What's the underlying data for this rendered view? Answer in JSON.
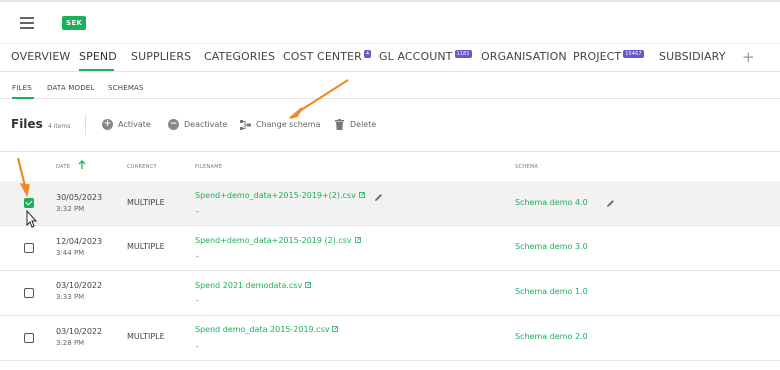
{
  "topbar": {
    "currency": "SEK",
    "menu_icon": "hamburger-icon"
  },
  "nav": {
    "items": [
      {
        "label": "OVERVIEW"
      },
      {
        "label": "SPEND"
      },
      {
        "label": "SUPPLIERS"
      },
      {
        "label": "CATEGORIES"
      },
      {
        "label": "COST CENTER",
        "badge": "4"
      },
      {
        "label": "GL ACCOUNT",
        "badge": "1181"
      },
      {
        "label": "ORGANISATION"
      },
      {
        "label": "PROJECT",
        "badge": "15467"
      },
      {
        "label": "SUBSIDIARY"
      }
    ],
    "active": "SPEND",
    "add_label": "+"
  },
  "subnav": {
    "items": [
      {
        "label": "FILES"
      },
      {
        "label": "DATA MODEL"
      },
      {
        "label": "SCHEMAS"
      }
    ],
    "active": "FILES"
  },
  "toolbar": {
    "title": "Files",
    "count": "4 items",
    "activate": "Activate",
    "deactivate": "Deactivate",
    "change_schema": "Change schema",
    "delete": "Delete"
  },
  "table": {
    "headers": {
      "date": "DATE",
      "currency": "CURRENCY",
      "filename": "FILENAME",
      "schema": "SCHEMA"
    },
    "sort": "ascending",
    "rows": [
      {
        "checked": true,
        "date": "30/05/2023",
        "time": "3:32 PM",
        "currency": "MULTIPLE",
        "filename": "Spend+demo_data+2015-2019+(2).csv",
        "sub": "-",
        "schema": "Schema demo 4.0"
      },
      {
        "checked": false,
        "date": "12/04/2023",
        "time": "3:44 PM",
        "currency": "MULTIPLE",
        "filename": "Spend+demo_data+2015-2019 (2).csv",
        "sub": "-",
        "schema": "Schema demo 3.0"
      },
      {
        "checked": false,
        "date": "03/10/2022",
        "time": "3:33 PM",
        "currency": "",
        "filename": "Spend 2021 demodata.csv",
        "sub": "-",
        "schema": "Schema demo 1.0"
      },
      {
        "checked": false,
        "date": "03/10/2022",
        "time": "3:28 PM",
        "currency": "MULTIPLE",
        "filename": "Spend demo_data 2015-2019.csv",
        "sub": "-",
        "schema": "Schema demo 2.0"
      }
    ]
  },
  "colors": {
    "accent": "#1bb05c",
    "badge": "#6558c8",
    "annotation": "#f08a24"
  }
}
